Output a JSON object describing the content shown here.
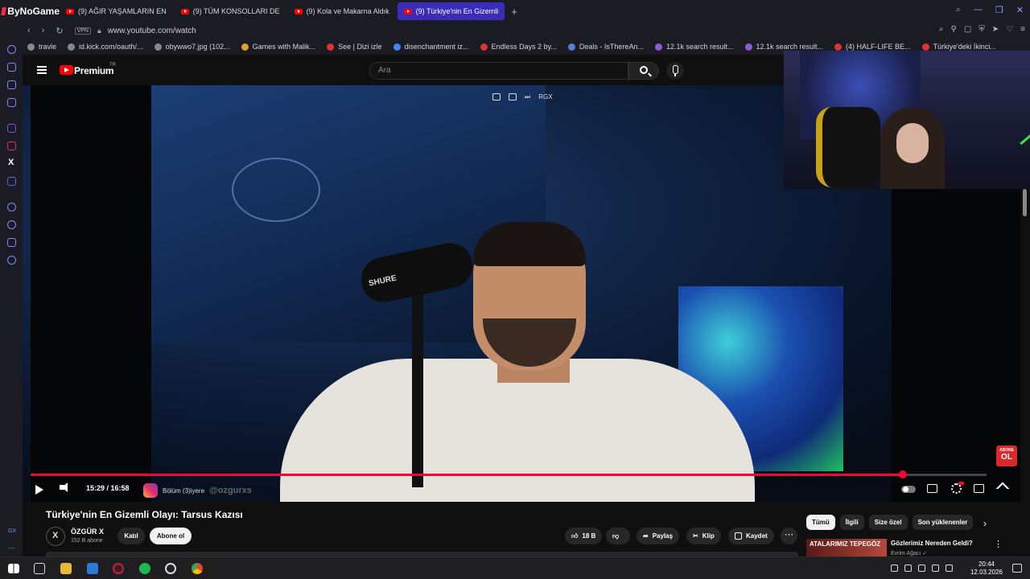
{
  "browser": {
    "brand": "ByNoGame",
    "tabs": [
      {
        "label": "(9) AĞIR YAŞAMLARIN EN",
        "active": false
      },
      {
        "label": "(9) TÜM KONSOLLARI DE",
        "active": false
      },
      {
        "label": "(9) Kola ve Makarna Aldık",
        "active": false
      },
      {
        "label": "(9) Türkiye'nin En Gizemli",
        "active": true
      }
    ],
    "new_tab": "+",
    "vpn": "VPN",
    "url": "www.youtube.com/watch",
    "bookmarks": [
      "travle",
      "id.kick.com/oauth/...",
      "obywwo7.jpg (102...",
      "Games with Malik...",
      "See | Dizi izle",
      "disenchantment iz...",
      "Endless Days 2 by...",
      "Deals - IsThereAn...",
      "12.1k search result...",
      "12.1k search result...",
      "(4) HALF-LIFE BE...",
      "Türkiye'deki İkinci..."
    ]
  },
  "youtube": {
    "brand": "Premium",
    "region": "TR",
    "search_placeholder": "Ara",
    "overlay_label": "RGX",
    "player": {
      "time": "15:29 / 16:58",
      "progress_fraction": 0.9125,
      "chapter_label": "Bölüm (3)iyere",
      "chapter_handle": "@ozgurxs",
      "subscribe_badge_top": "ABONE",
      "subscribe_badge_big": "OL",
      "mic_brand": "SHURE"
    },
    "video_title": "Türkiye'nin En Gizemli Olayı: Tarsus Kazısı",
    "channel": {
      "name": "ÖZGÜR X",
      "subscribers": "152 B abone"
    },
    "join_label": "Katıl",
    "subscribe_label": "Abone ol",
    "actions": {
      "likes": "18 B",
      "share": "Paylaş",
      "clip": "Klip",
      "save": "Kaydet",
      "more": "⋯"
    },
    "chips": [
      "Tümü",
      "İlgili",
      "Size özel",
      "Son yüklenenler"
    ],
    "recommendation": {
      "thumb_text": "ATALARIMIZ TEPEGÖZ",
      "title": "Gözlerimiz Nereden Geldi?",
      "channel": "Evrim Ağacı ✓"
    }
  },
  "taskbar": {
    "time": "20:44",
    "date": "12.03.2026",
    "sidebar_label": "GX"
  }
}
